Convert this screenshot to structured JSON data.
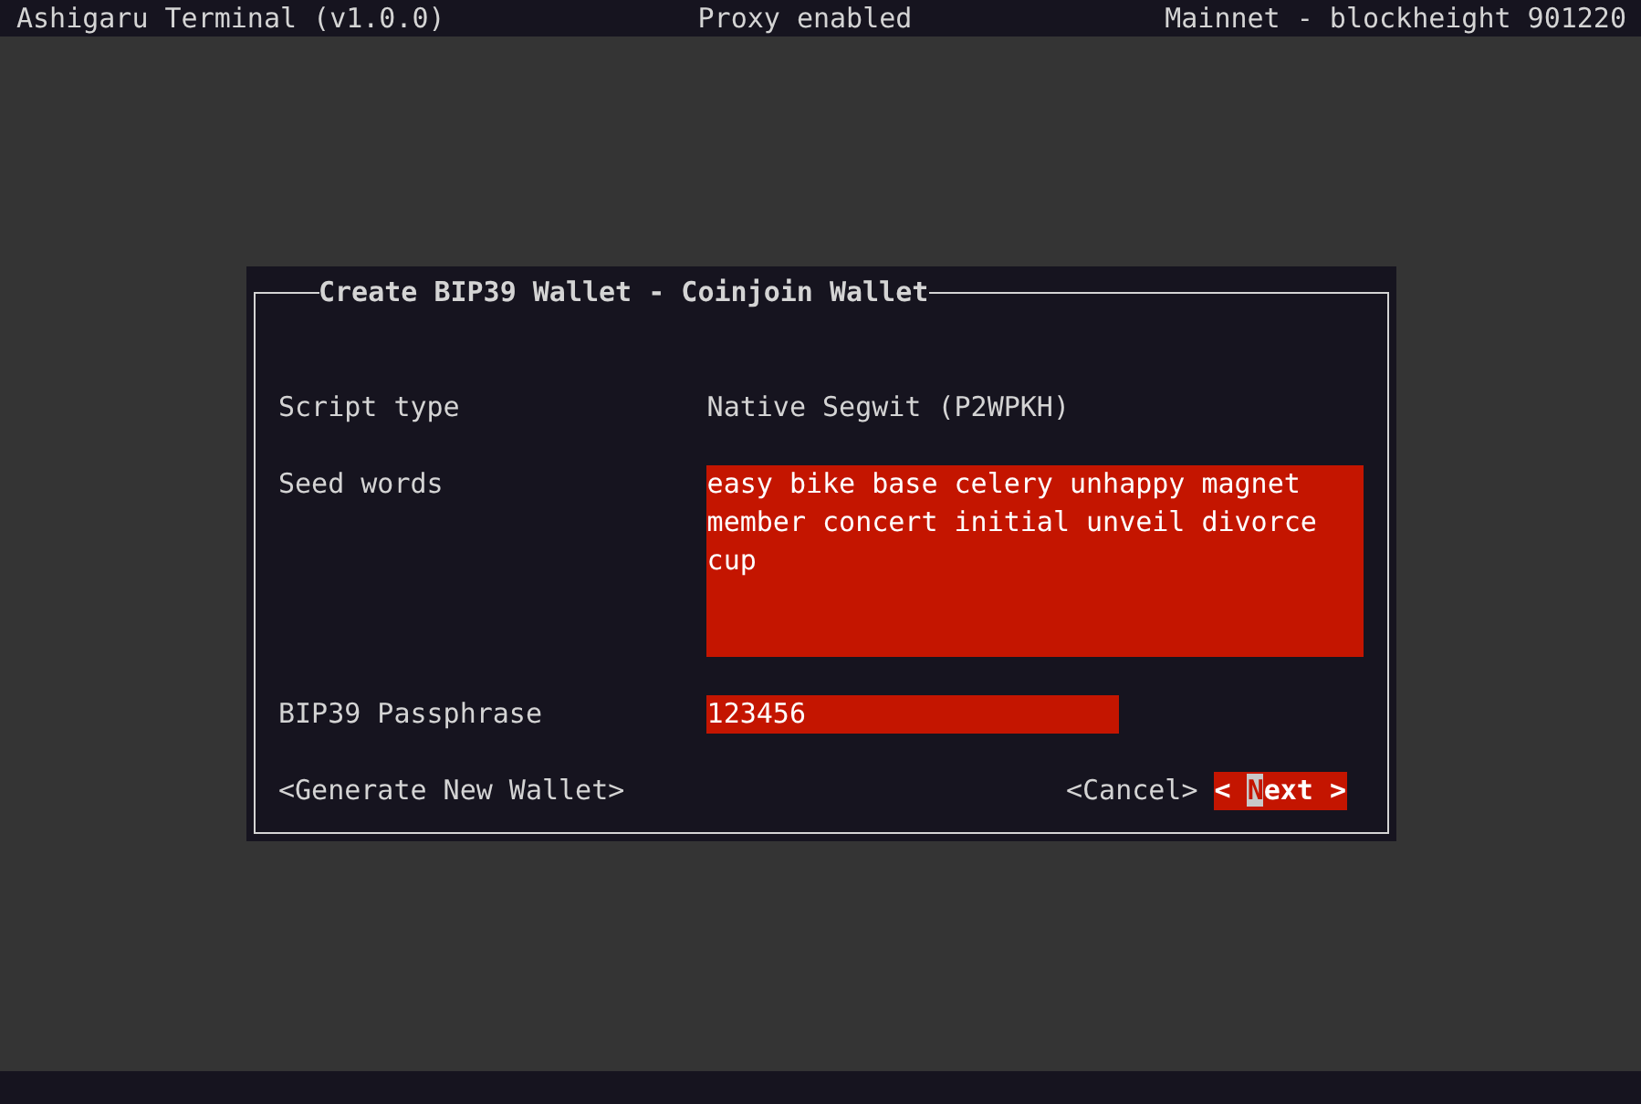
{
  "status_bar": {
    "app": "Ashigaru Terminal (v1.0.0)",
    "proxy": "Proxy enabled",
    "network": "Mainnet - blockheight 901220"
  },
  "dialog": {
    "title": "Create BIP39 Wallet - Coinjoin Wallet",
    "fields": [
      {
        "kind": "text",
        "label": "Script type",
        "value": "Native Segwit (P2WPKH)"
      },
      {
        "kind": "textarea",
        "label": "Seed words",
        "value": "easy bike base celery unhappy magnet member concert initial unveil divorce cup"
      },
      {
        "kind": "input",
        "label": "BIP39 Passphrase",
        "value": "123456"
      }
    ],
    "buttons": [
      {
        "label": "<Generate New Wallet>",
        "focused": false
      },
      {
        "label": "<Cancel>",
        "focused": false
      },
      {
        "label": "< Next >",
        "focused": true
      }
    ]
  }
}
